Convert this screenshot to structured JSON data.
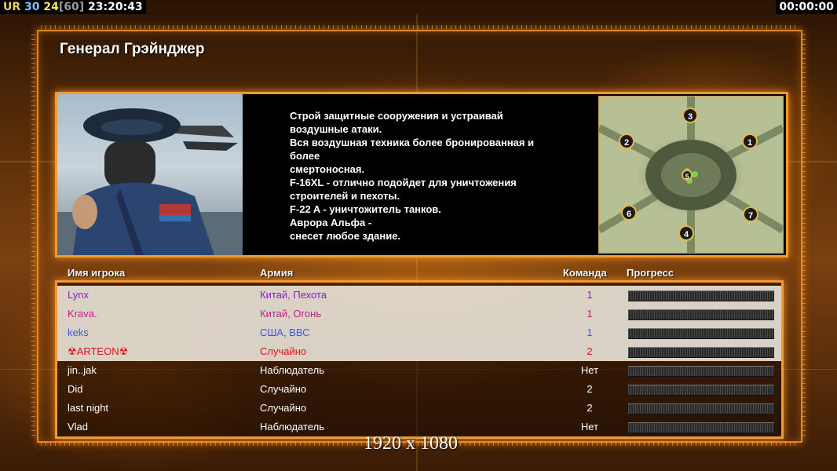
{
  "hud": {
    "ur_label": "UR",
    "fps": "30",
    "frame_a": "24",
    "frame_b": "[60]",
    "clock": "23:20:43",
    "timer": "00:00:00"
  },
  "general": {
    "title": "Генерал Грэйнджер",
    "description": "Строй защитные сооружения и устраивай\n воздушные атаки.\nВся воздушная техника более бронированная и\n более\nсмертоносная.\nF-16XL - отлично подойдет для уничтожения\n строителей и пехоты.\nF-22 A - уничтожитель танков.\nАврора Альфа -\nснесет любое здание."
  },
  "map": {
    "spots": [
      "1",
      "2",
      "3",
      "4",
      "5",
      "6",
      "7"
    ]
  },
  "table": {
    "headers": {
      "name": "Имя игрока",
      "army": "Армия",
      "team": "Команда",
      "progress": "Прогресс"
    },
    "rows": [
      {
        "name": "Lynx",
        "army": "Китай, Пехота",
        "team": "1",
        "color": "#8a1ec0",
        "highlight": true
      },
      {
        "name": "Krava.",
        "army": "Китай, Огонь",
        "team": "1",
        "color": "#c0208c",
        "highlight": true
      },
      {
        "name": "keks",
        "army": "США, ВВС",
        "team": "1",
        "color": "#3f5ad8",
        "highlight": true
      },
      {
        "name": "☢ARTEON☢",
        "army": "Случайно",
        "team": "2",
        "color": "#e01010",
        "highlight": true
      },
      {
        "name": "jin..jak",
        "army": "Наблюдатель",
        "team": "Нет",
        "color": "#ffffff",
        "highlight": false
      },
      {
        "name": "Did",
        "army": "Случайно",
        "team": "2",
        "color": "#ffffff",
        "highlight": false
      },
      {
        "name": "last night",
        "army": "Случайно",
        "team": "2",
        "color": "#ffffff",
        "highlight": false
      },
      {
        "name": "Vlad",
        "army": "Наблюдатель",
        "team": "Нет",
        "color": "#ffffff",
        "highlight": false
      }
    ]
  },
  "resolution": "1920 x 1080",
  "colors": {
    "accent": "#f29a32",
    "panel": "#000000"
  }
}
